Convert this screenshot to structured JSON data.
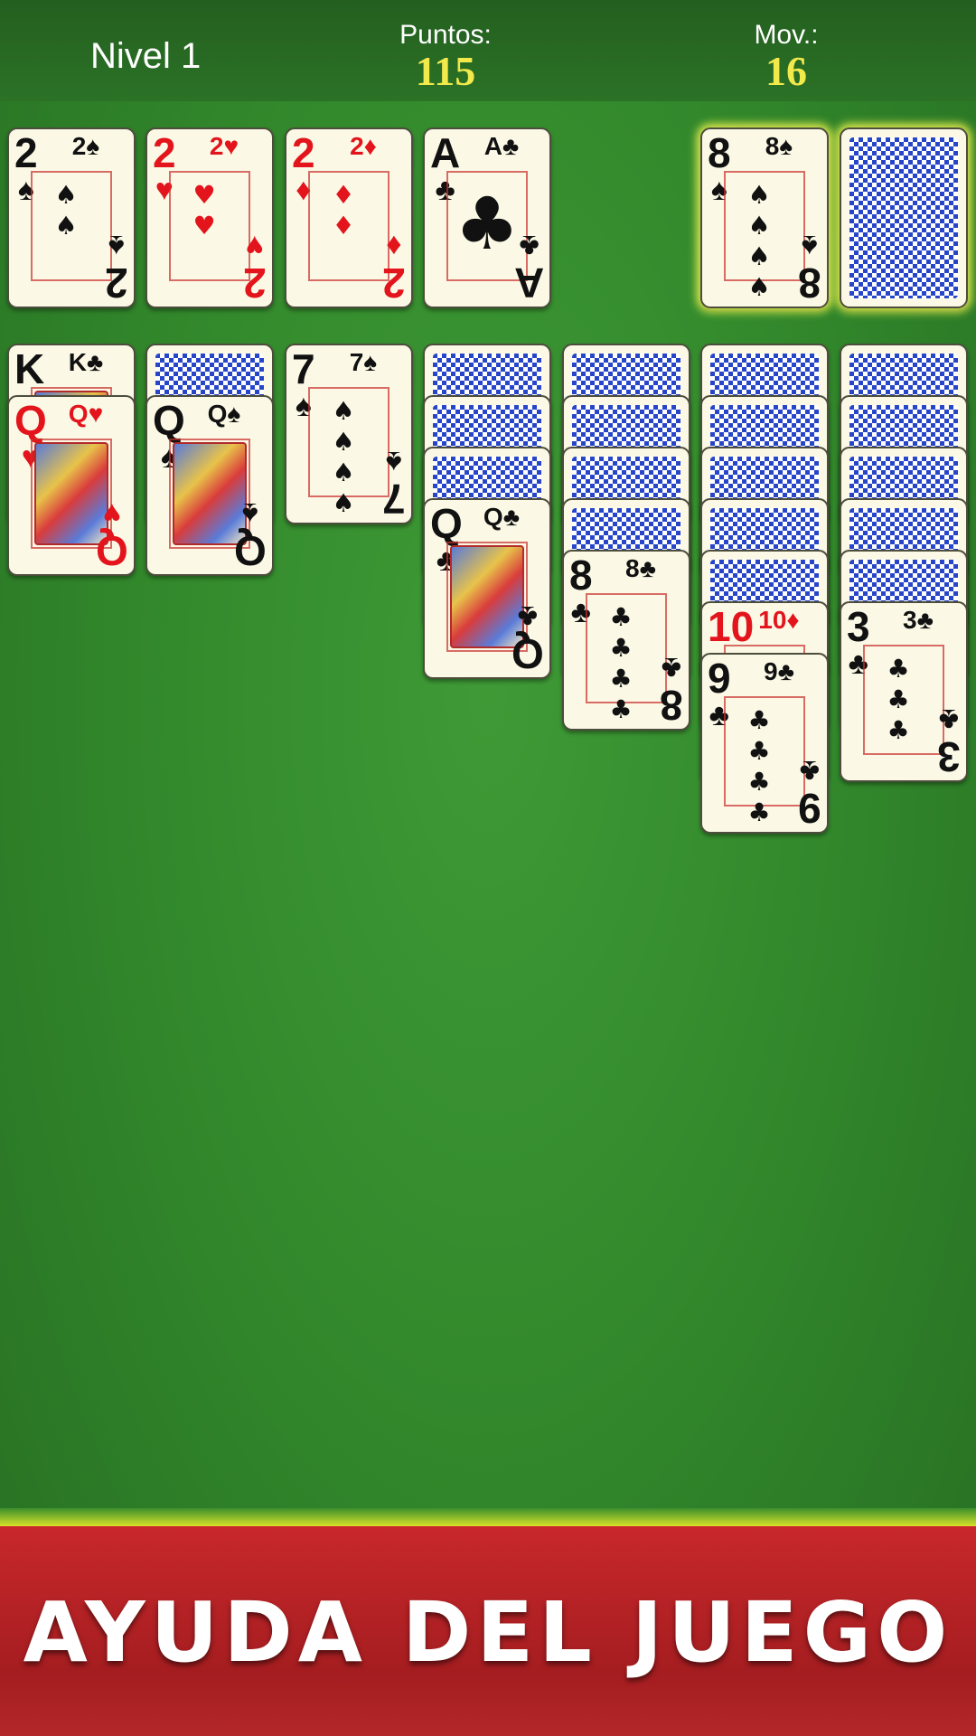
{
  "hud": {
    "level": "Nivel 1",
    "score_label": "Puntos:",
    "score_value": "115",
    "moves_label": "Mov.:",
    "moves_value": "16"
  },
  "foundations": [
    {
      "rank": "2",
      "suit": "♠",
      "color": "black"
    },
    {
      "rank": "2",
      "suit": "♥",
      "color": "red"
    },
    {
      "rank": "2",
      "suit": "♦",
      "color": "red"
    },
    {
      "rank": "A",
      "suit": "♣",
      "color": "black"
    }
  ],
  "waste": {
    "rank": "8",
    "suit": "♠",
    "color": "black"
  },
  "tableau": [
    {
      "hidden": 0,
      "up": [
        {
          "rank": "K",
          "suit": "♣",
          "color": "black"
        },
        {
          "rank": "Q",
          "suit": "♥",
          "color": "red"
        }
      ]
    },
    {
      "hidden": 1,
      "up": [
        {
          "rank": "Q",
          "suit": "♠",
          "color": "black"
        }
      ]
    },
    {
      "hidden": 0,
      "up": [
        {
          "rank": "7",
          "suit": "♠",
          "color": "black"
        }
      ]
    },
    {
      "hidden": 3,
      "up": [
        {
          "rank": "Q",
          "suit": "♣",
          "color": "black"
        }
      ]
    },
    {
      "hidden": 4,
      "up": [
        {
          "rank": "8",
          "suit": "♣",
          "color": "black"
        }
      ]
    },
    {
      "hidden": 5,
      "up": [
        {
          "rank": "10",
          "suit": "♦",
          "color": "red"
        },
        {
          "rank": "9",
          "suit": "♣",
          "color": "black"
        }
      ]
    },
    {
      "hidden": 5,
      "up": [
        {
          "rank": "3",
          "suit": "♣",
          "color": "black"
        }
      ]
    }
  ],
  "footer": {
    "title": "AYUDA DEL JUEGO"
  }
}
